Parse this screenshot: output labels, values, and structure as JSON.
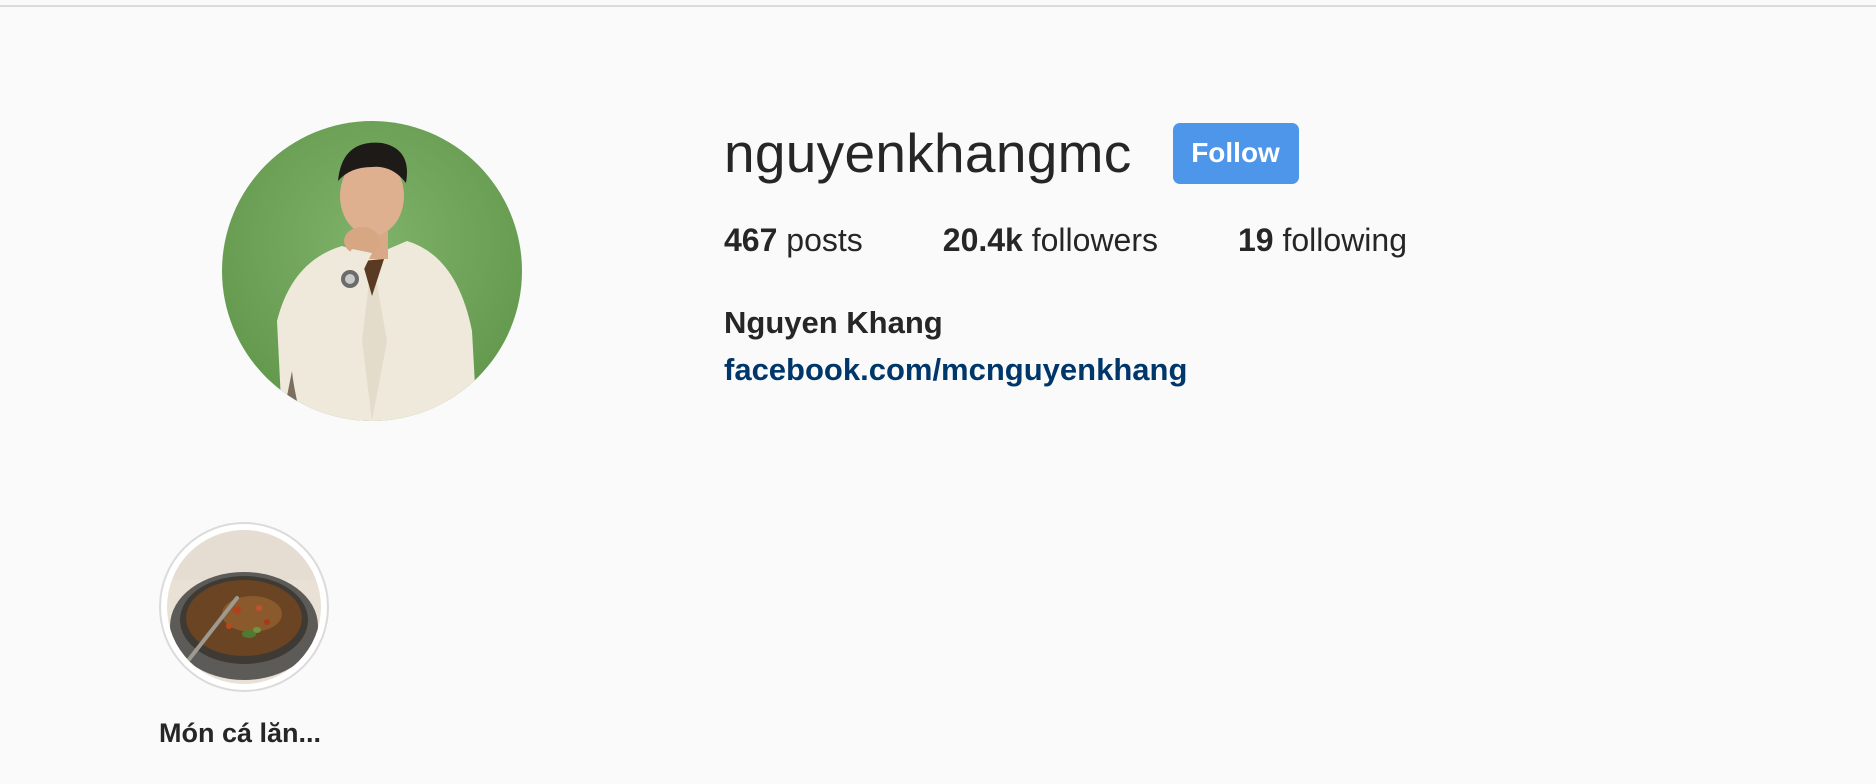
{
  "profile": {
    "username": "nguyenkhangmc",
    "follow_label": "Follow",
    "full_name": "Nguyen Khang",
    "link": "facebook.com/mcnguyenkhang",
    "avatar_icon": "profile-photo"
  },
  "stats": {
    "posts_count": "467",
    "posts_label": " posts",
    "followers_count": "20.4k",
    "followers_label": " followers",
    "following_count": "19",
    "following_label": " following"
  },
  "highlights": [
    {
      "label": "Món cá lăn..."
    }
  ],
  "colors": {
    "background": "#fafafa",
    "follow_button": "#4d96ea",
    "link": "#00376b",
    "text": "#262626"
  }
}
